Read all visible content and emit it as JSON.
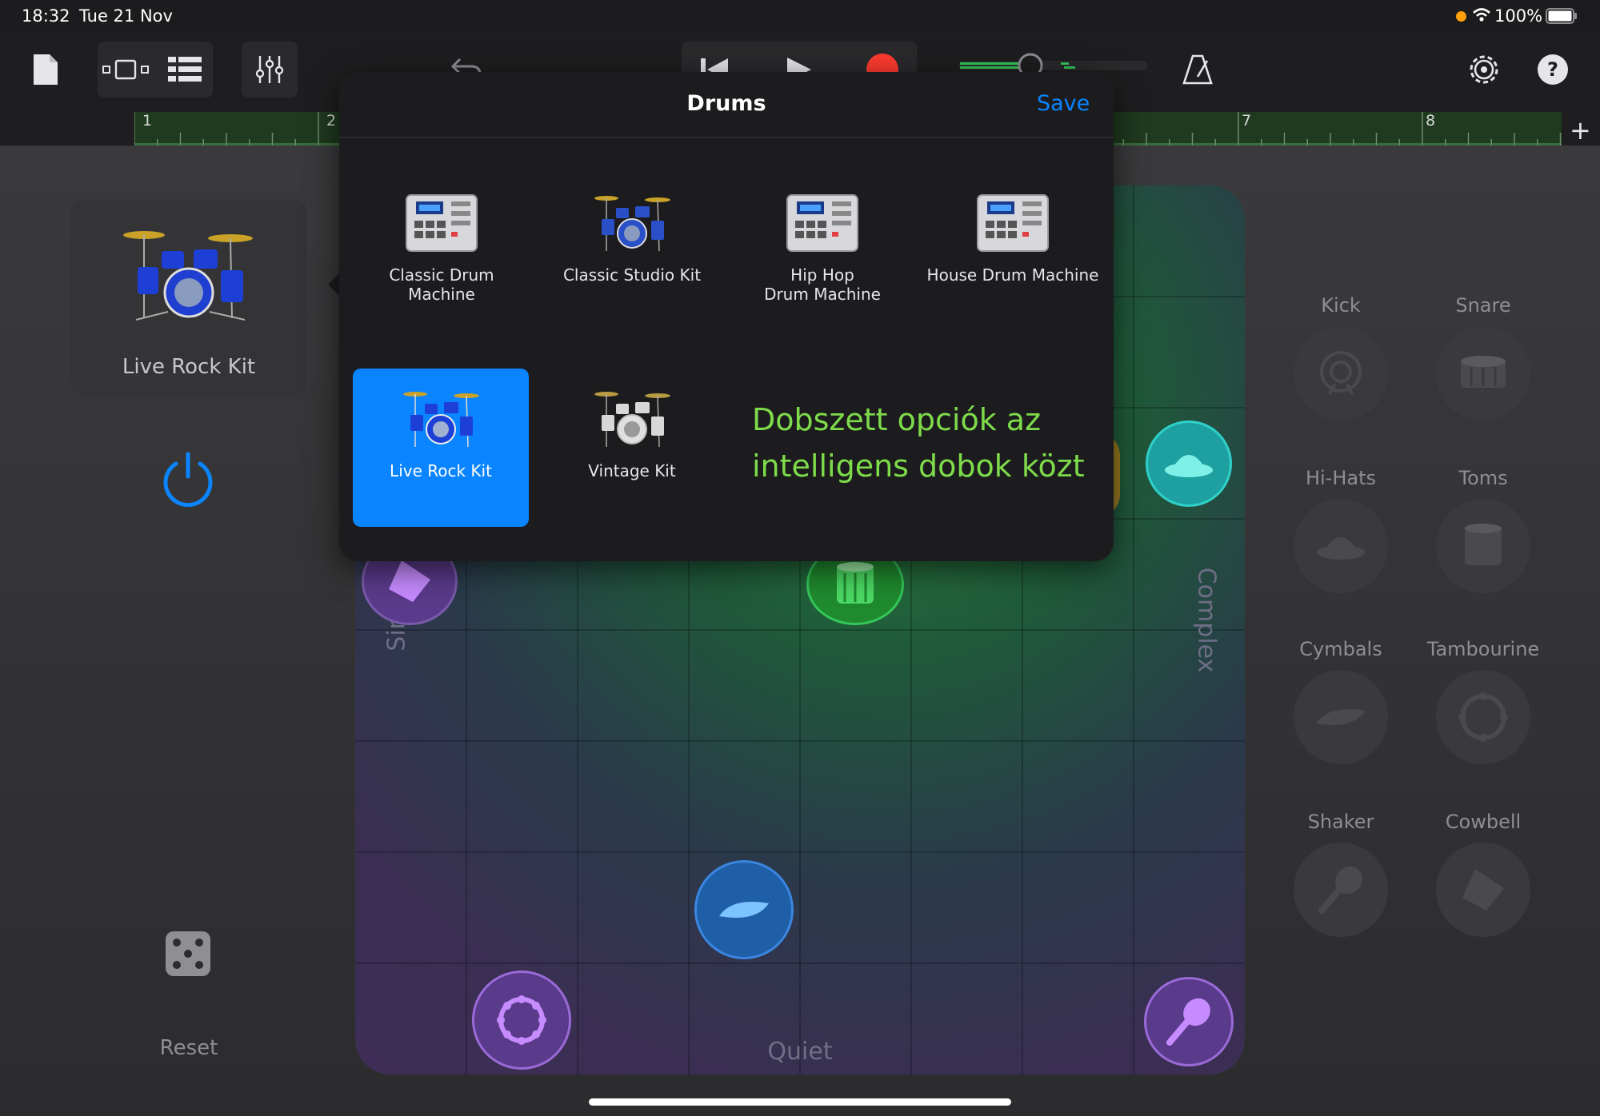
{
  "status": {
    "time": "18:32",
    "date": "Tue 21 Nov",
    "battery": "100%"
  },
  "ruler": {
    "marks": [
      "1",
      "2",
      "7",
      "8"
    ]
  },
  "sidebar": {
    "kit_name": "Live Rock Kit",
    "reset_label": "Reset"
  },
  "popup": {
    "title": "Drums",
    "save_label": "Save",
    "kits": [
      {
        "label": "Classic Drum\nMachine",
        "icon": "drum-machine"
      },
      {
        "label": "Classic Studio Kit",
        "icon": "drum-kit"
      },
      {
        "label": "Hip Hop\nDrum Machine",
        "icon": "drum-machine"
      },
      {
        "label": "House Drum Machine",
        "icon": "drum-machine"
      },
      {
        "label": "Live Rock Kit",
        "icon": "drum-kit",
        "selected": true
      },
      {
        "label": "Vintage Kit",
        "icon": "drum-kit"
      }
    ],
    "annotation": "Dobszett opciók az intelligens dobok közt"
  },
  "pad": {
    "left_label": "Simple",
    "right_label": "Complex",
    "bottom_label": "Quiet"
  },
  "instruments": [
    "Kick",
    "Snare",
    "Hi-Hats",
    "Toms",
    "Cymbals",
    "Tambourine",
    "Shaker",
    "Cowbell"
  ],
  "colors": {
    "accent": "#0a84ff",
    "record": "#ff3b30",
    "annotation": "#7edb4a"
  }
}
